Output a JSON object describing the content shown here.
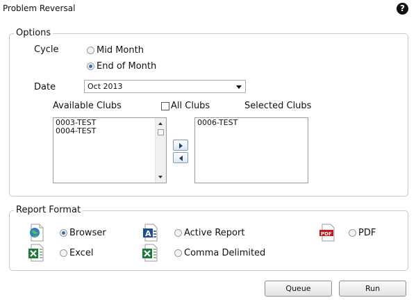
{
  "window": {
    "title": "Problem Reversal",
    "help_glyph": "?"
  },
  "options": {
    "legend": "Options",
    "cycle_label": "Cycle",
    "cycle_options": [
      {
        "label": "Mid Month",
        "selected": false
      },
      {
        "label": "End of Month",
        "selected": true
      }
    ],
    "date_label": "Date",
    "date_value": "Oct 2013",
    "available_label": "Available Clubs",
    "all_clubs_label": "All Clubs",
    "all_clubs_checked": false,
    "selected_label": "Selected Clubs",
    "available_clubs": [
      "0003-TEST",
      "0004-TEST"
    ],
    "selected_clubs": [
      "0006-TEST"
    ]
  },
  "report_format": {
    "legend": "Report Format",
    "formats": [
      {
        "label": "Browser",
        "selected": true,
        "icon": "globe-document-icon"
      },
      {
        "label": "Active Report",
        "selected": false,
        "icon": "active-report-icon"
      },
      {
        "label": "PDF",
        "selected": false,
        "icon": "pdf-icon",
        "icon_text": "PDF"
      },
      {
        "label": "Excel",
        "selected": false,
        "icon": "excel-icon"
      },
      {
        "label": "Comma Delimited",
        "selected": false,
        "icon": "csv-excel-icon"
      }
    ]
  },
  "actions": {
    "queue_label": "Queue",
    "run_label": "Run"
  },
  "colors": {
    "radio_dot": "#3a6ea5",
    "pdf_red": "#c4161c",
    "excel_green": "#1d7a3a",
    "globe_blue": "#2f7fc1"
  }
}
